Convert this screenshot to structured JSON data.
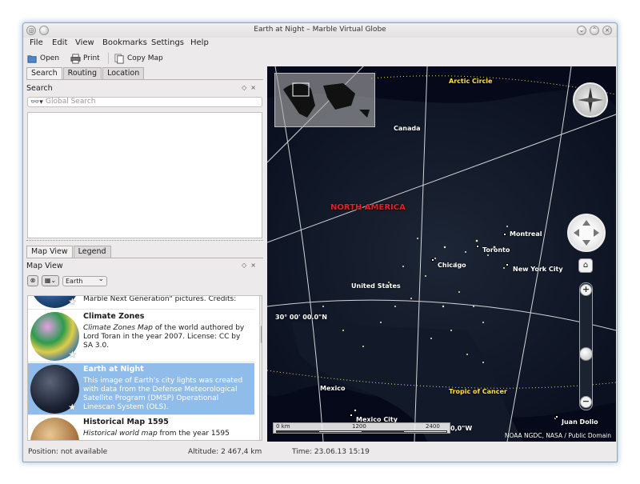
{
  "window": {
    "title": "Earth at Night – Marble Virtual Globe"
  },
  "menu": [
    "File",
    "Edit",
    "View",
    "Bookmarks",
    "Settings",
    "Help"
  ],
  "toolbar": {
    "open": "Open",
    "print": "Print",
    "copy_map": "Copy Map"
  },
  "top_tabs": [
    "Search",
    "Routing",
    "Location"
  ],
  "search_dock": {
    "title": "Search",
    "placeholder": "Global Search"
  },
  "bottom_tabs": [
    "Map View",
    "Legend"
  ],
  "mapview_dock": {
    "title": "Map View",
    "celestial_body": "Earth"
  },
  "map_themes": [
    {
      "title": "",
      "desc": "The map is based on NASA's beautiful \"Blue Marble Next Generation\" pictures. Credits:"
    },
    {
      "title": "Climate Zones",
      "desc_em": "Climate Zones Map",
      "desc": " of the world authored by Lord Toran in the year 2007. License: CC by SA 3.0."
    },
    {
      "title": "Earth at Night",
      "desc": "This image of Earth's city lights was created with data from the Defense Meteorological Satellite Program (DMSP) Operational Linescan System (OLS)."
    },
    {
      "title": "Historical Map 1595",
      "desc_em": "Historical world map",
      "desc": " from the year 1595"
    }
  ],
  "map": {
    "labels": {
      "arctic_circle": "Arctic Circle",
      "canada": "Canada",
      "north_america": "NORTH AMERICA",
      "montreal": "Montreal",
      "toronto": "Toronto",
      "new_york": "New York City",
      "chicago": "Chicago",
      "united_states": "United States",
      "lat30": "30° 00' 00.0\"N",
      "mexico": "Mexico",
      "tropic_cancer": "Tropic of Cancer",
      "mexico_city": "Mexico City",
      "juan_dolio": "Juan Dolio",
      "lon": "0,0\"W"
    },
    "scale": {
      "zero": "0 km",
      "mid": "1200",
      "max": "2400"
    },
    "credit": "NOAA NGDC, NASA / Public Domain",
    "zoom_plus": "+",
    "zoom_minus": "−"
  },
  "status": {
    "position": "Position: not available",
    "altitude": "Altitude:  2 467,4 km",
    "time": "Time: 23.06.13 15:19"
  }
}
